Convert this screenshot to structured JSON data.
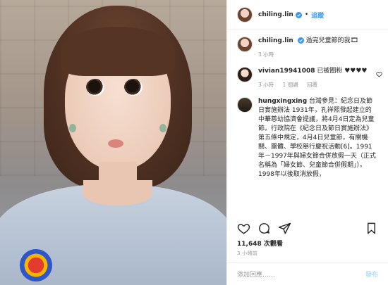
{
  "post": {
    "username": "chiling.lin",
    "follow_label": "追蹤",
    "separator": "•"
  },
  "comments": [
    {
      "username": "chiling.lin",
      "text": "過完兒童節的我🎞",
      "time": "3 小時",
      "reply": ""
    },
    {
      "username": "vivian19941008",
      "text": "已被圈粉 ♥♥♥♥",
      "time": "3 小時",
      "likes": "1 個讚",
      "reply": "回覆"
    },
    {
      "username": "hungxingxing",
      "text": "台灣參見：紀念日及節日實施辦法 1931年，孔祥熙發起建立的中華慈幼協濟會提議，將4月4日定為兒童節。行政院在《紀念日及節日實施辦法》第五條中規定，4月4日兒童節，有關機關、團體、學校舉行慶祝活動[6]。1991年－1997年與婦女節合併放假一天（正式名稱為「婦女節、兒童節合併假期」）。1998年以後取消放假，",
      "time": "",
      "reply": ""
    }
  ],
  "stats": {
    "views": "11,648 次觀看",
    "posted": "3 小時前"
  },
  "add_comment": {
    "placeholder": "添加回應……",
    "post_label": "發布"
  },
  "icons": {
    "verified": "verified-badge-icon",
    "like": "heart-icon",
    "comment": "comment-icon",
    "share": "share-icon",
    "save": "bookmark-icon"
  },
  "colors": {
    "accent": "#3897f0",
    "muted": "#999999",
    "post_disabled": "#b2dffc"
  }
}
